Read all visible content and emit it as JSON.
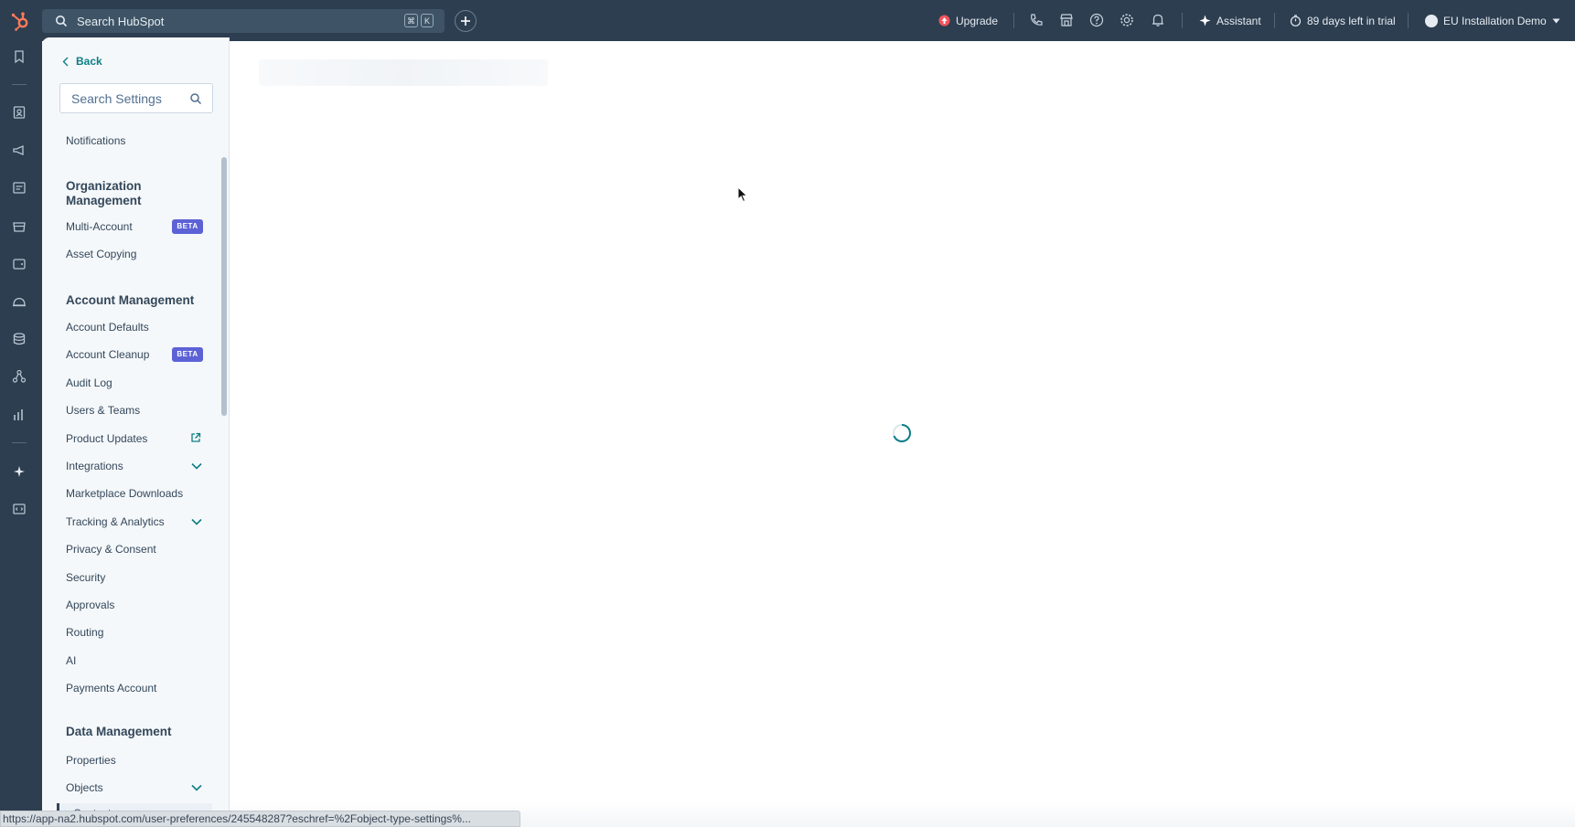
{
  "topbar": {
    "search_placeholder": "Search HubSpot",
    "shortcut_keys": [
      "⌘",
      "K"
    ],
    "upgrade_label": "Upgrade",
    "assistant_label": "Assistant",
    "trial_label": "89 days left in trial",
    "account_label": "EU Installation Demo"
  },
  "sidebar": {
    "back_label": "Back",
    "search_placeholder": "Search Settings",
    "items": [
      {
        "label": "Notifications"
      },
      {
        "heading": "Organization Management"
      },
      {
        "label": "Multi-Account",
        "badge": "BETA"
      },
      {
        "label": "Asset Copying"
      },
      {
        "heading": "Account Management"
      },
      {
        "label": "Account Defaults"
      },
      {
        "label": "Account Cleanup",
        "badge": "BETA"
      },
      {
        "label": "Audit Log"
      },
      {
        "label": "Users & Teams"
      },
      {
        "label": "Product Updates"
      },
      {
        "label": "Integrations"
      },
      {
        "label": "Marketplace Downloads"
      },
      {
        "label": "Tracking & Analytics"
      },
      {
        "label": "Privacy & Consent"
      },
      {
        "label": "Security"
      },
      {
        "label": "Approvals"
      },
      {
        "label": "Routing"
      },
      {
        "label": "AI"
      },
      {
        "label": "Payments Account"
      },
      {
        "heading": "Data Management"
      },
      {
        "label": "Properties"
      },
      {
        "label": "Objects"
      },
      {
        "label": "Contacts"
      }
    ]
  },
  "status_url": "https://app-na2.hubspot.com/user-preferences/245548287?eschref=%2Fobject-type-settings%...",
  "colors": {
    "topbar": "#2d3e50",
    "accent_teal": "#0b7e87",
    "badge": "#5c62d6",
    "upgrade_dot": "#f2545b"
  }
}
